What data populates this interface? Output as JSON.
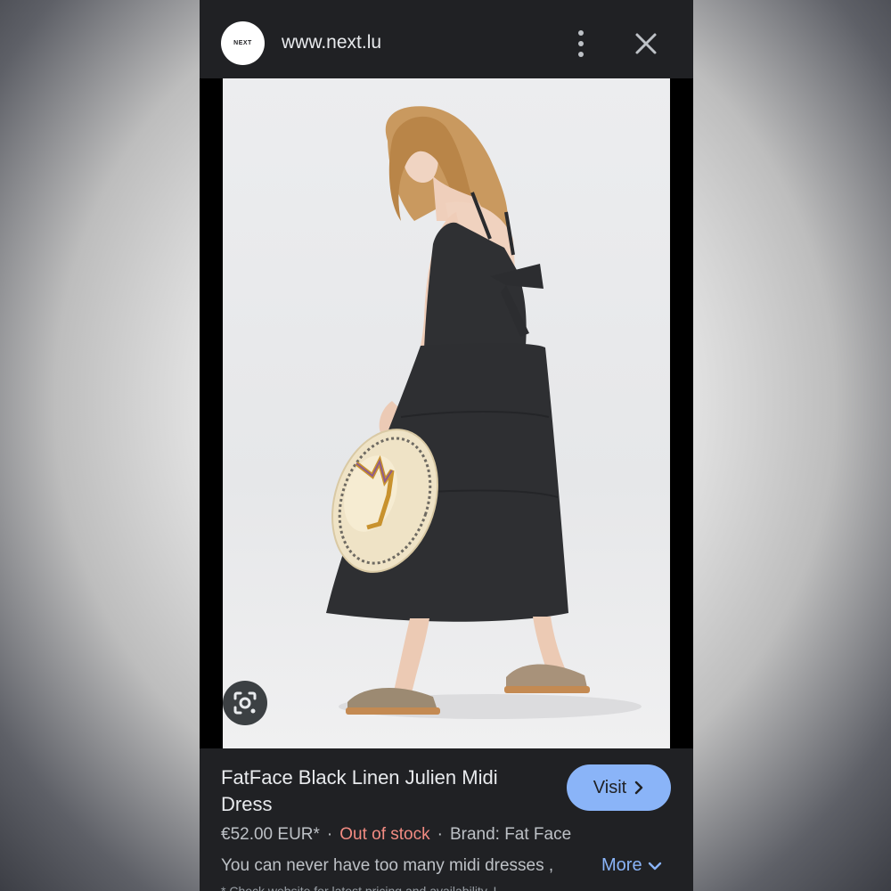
{
  "header": {
    "logo_text": "NEXT",
    "url": "www.next.lu"
  },
  "image": {
    "description_icon": "google-lens-icon"
  },
  "product": {
    "title": "FatFace Black Linen Julien Midi Dress",
    "visit_label": "Visit",
    "price": "€52.00 EUR*",
    "separator": "·",
    "stock_status": "Out of stock",
    "brand": "Brand: Fat Face",
    "description": "You can never have too many midi dresses ,",
    "more_label": "More",
    "footnote": "* Check website for latest pricing and availability. I"
  },
  "colors": {
    "background": "#202124",
    "accent": "#8ab4f8",
    "out_of_stock": "#f28b82",
    "text_primary": "#e8eaed",
    "text_secondary": "#bdc1c6"
  }
}
